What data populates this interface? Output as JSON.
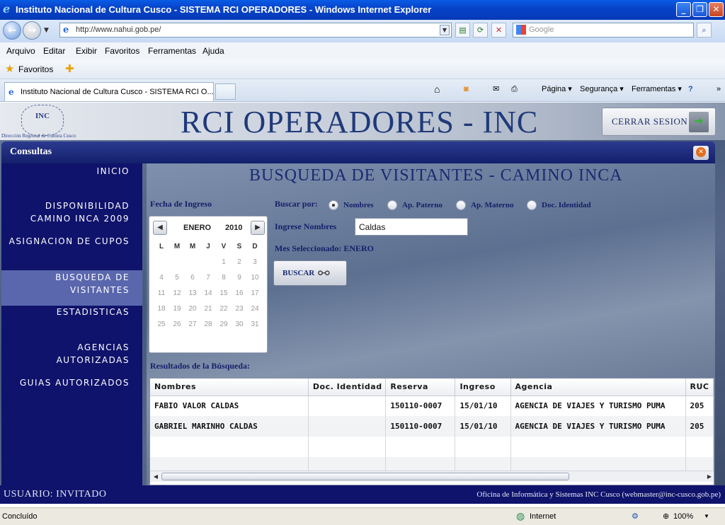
{
  "window": {
    "title": "Instituto Nacional de Cultura Cusco - SISTEMA RCI OPERADORES - Windows Internet Explorer",
    "minimize": "_",
    "restore": "❐",
    "close": "✕"
  },
  "address_bar": {
    "url": "http://www.nahui.gob.pe/",
    "search_placeholder": "Google"
  },
  "menu": [
    "Arquivo",
    "Editar",
    "Exibir",
    "Favoritos",
    "Ferramentas",
    "Ajuda"
  ],
  "favorites_bar": {
    "label": "Favoritos"
  },
  "tab": {
    "title": "Instituto Nacional de Cultura Cusco - SISTEMA RCI O..."
  },
  "command_bar": {
    "page": "Página ▾",
    "security": "Segurança ▾",
    "tools": "Ferramentas ▾",
    "more": "»"
  },
  "site": {
    "logo_text": "INC",
    "logo_subtitle": "Dirección Regional de Cultura Cusco",
    "banner_title": "RCI OPERADORES - INC",
    "logout_label": "CERRAR SESION"
  },
  "panel": {
    "title": "Consultas"
  },
  "sidebar": {
    "items": [
      {
        "label": "INICIO"
      },
      {
        "label": "DISPONIBILIDAD"
      },
      {
        "label": "CAMINO INCA 2009"
      },
      {
        "label": "ASIGNACION DE CUPOS"
      },
      {
        "label": "BUSQUEDA DE"
      },
      {
        "label": "VISITANTES"
      },
      {
        "label": "ESTADISTICAS"
      },
      {
        "label": "AGENCIAS"
      },
      {
        "label": "AUTORIZADAS"
      },
      {
        "label": "GUIAS AUTORIZADOS"
      }
    ]
  },
  "search": {
    "title": "BUSQUEDA DE VISITANTES - CAMINO INCA",
    "date_label": "Fecha de Ingreso",
    "search_by_label": "Buscar por:",
    "options": [
      "Nombres",
      "Ap. Paterno",
      "Ap. Materno",
      "Doc. Identidad"
    ],
    "selected_option": "Nombres",
    "input_label": "Ingrese Nombres",
    "input_value": "Caldas",
    "month_selected": "Mes Seleccionado: ENERO",
    "button_label": "BUSCAR",
    "results_label": "Resultados de la Búsqueda:"
  },
  "calendar": {
    "month": "ENERO",
    "year": "2010",
    "weekdays": [
      "L",
      "M",
      "M",
      "J",
      "V",
      "S",
      "D"
    ],
    "weeks": [
      [
        "",
        "",
        "",
        "",
        "1",
        "2",
        "3"
      ],
      [
        "4",
        "5",
        "6",
        "7",
        "8",
        "9",
        "10"
      ],
      [
        "11",
        "12",
        "13",
        "14",
        "15",
        "16",
        "17"
      ],
      [
        "18",
        "19",
        "20",
        "21",
        "22",
        "23",
        "24"
      ],
      [
        "25",
        "26",
        "27",
        "28",
        "29",
        "30",
        "31"
      ]
    ]
  },
  "results": {
    "columns": [
      "Nombres",
      "Doc. Identidad",
      "Reserva",
      "Ingreso",
      "Agencia",
      "RUC"
    ],
    "rows": [
      {
        "nombres": "FABIO VALOR CALDAS",
        "doc": "",
        "reserva": "150110-0007",
        "ingreso": "15/01/10",
        "agencia": "AGENCIA DE VIAJES Y TURISMO PUMA",
        "ruc": "205"
      },
      {
        "nombres": "GABRIEL MARINHO CALDAS",
        "doc": "",
        "reserva": "150110-0007",
        "ingreso": "15/01/10",
        "agencia": "AGENCIA DE VIAJES Y TURISMO PUMA",
        "ruc": "205"
      }
    ]
  },
  "footer": {
    "user": "USUARIO: INVITADO",
    "office": "Oficina de Informática y Sistemas INC Cusco (webmaster@inc-cusco.gob.pe)"
  },
  "statusbar": {
    "status": "Concluído",
    "zone": "Internet",
    "zoom": "100%"
  },
  "colors": {
    "sidebar_bg": "#0f136b",
    "panel_header": "#13206c",
    "title_text": "#1a2a72",
    "active_nav": "#5a67ad"
  }
}
